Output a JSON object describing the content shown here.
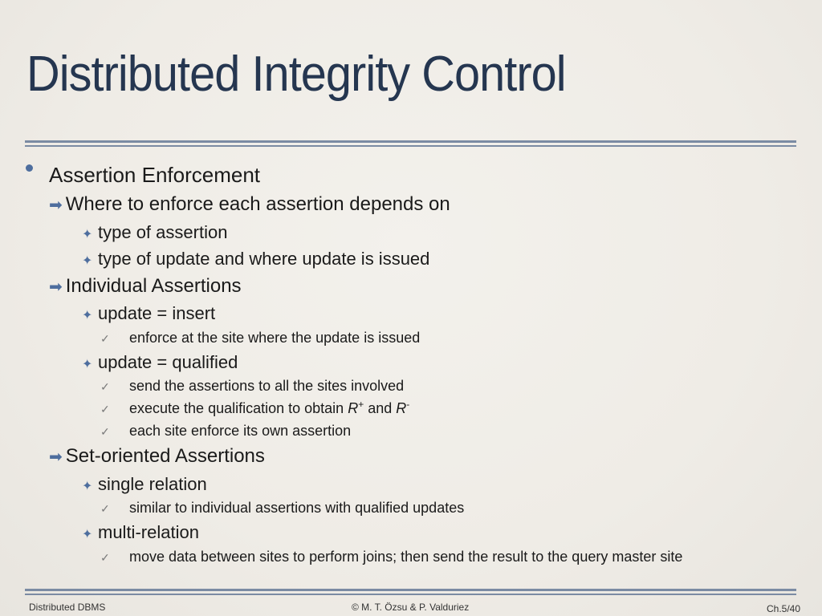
{
  "slide": {
    "title": "Distributed Integrity Control",
    "l0": "Assertion Enforcement",
    "where": "Where to enforce each assertion depends on",
    "type_assertion": "type of assertion",
    "type_update": "type of update and where update is issued",
    "individual": "Individual Assertions",
    "upd_insert": "update = insert",
    "insert_c1": "enforce at the site where the update is issued",
    "upd_qualified": "update = qualified",
    "qual_c1": "send the assertions to all the sites involved",
    "qual_c2_pre": "execute the qualification to obtain ",
    "qual_c2_r": "R",
    "qual_c2_plus": "+",
    "qual_c2_and": " and ",
    "qual_c2_minus": "-",
    "qual_c3": "each site enforce its own assertion",
    "set_oriented": "Set-oriented Assertions",
    "single": "single relation",
    "single_c1": "similar to individual assertions with qualified updates",
    "multi": "multi-relation",
    "multi_c1": "move data between sites to perform joins; then send the result to the query master site"
  },
  "footer": {
    "left": "Distributed DBMS",
    "center": "© M. T. Özsu & P. Valduriez",
    "right": "Ch.5/40"
  },
  "icons": {
    "arrow": "➡",
    "star": "✦",
    "check": "✓"
  }
}
